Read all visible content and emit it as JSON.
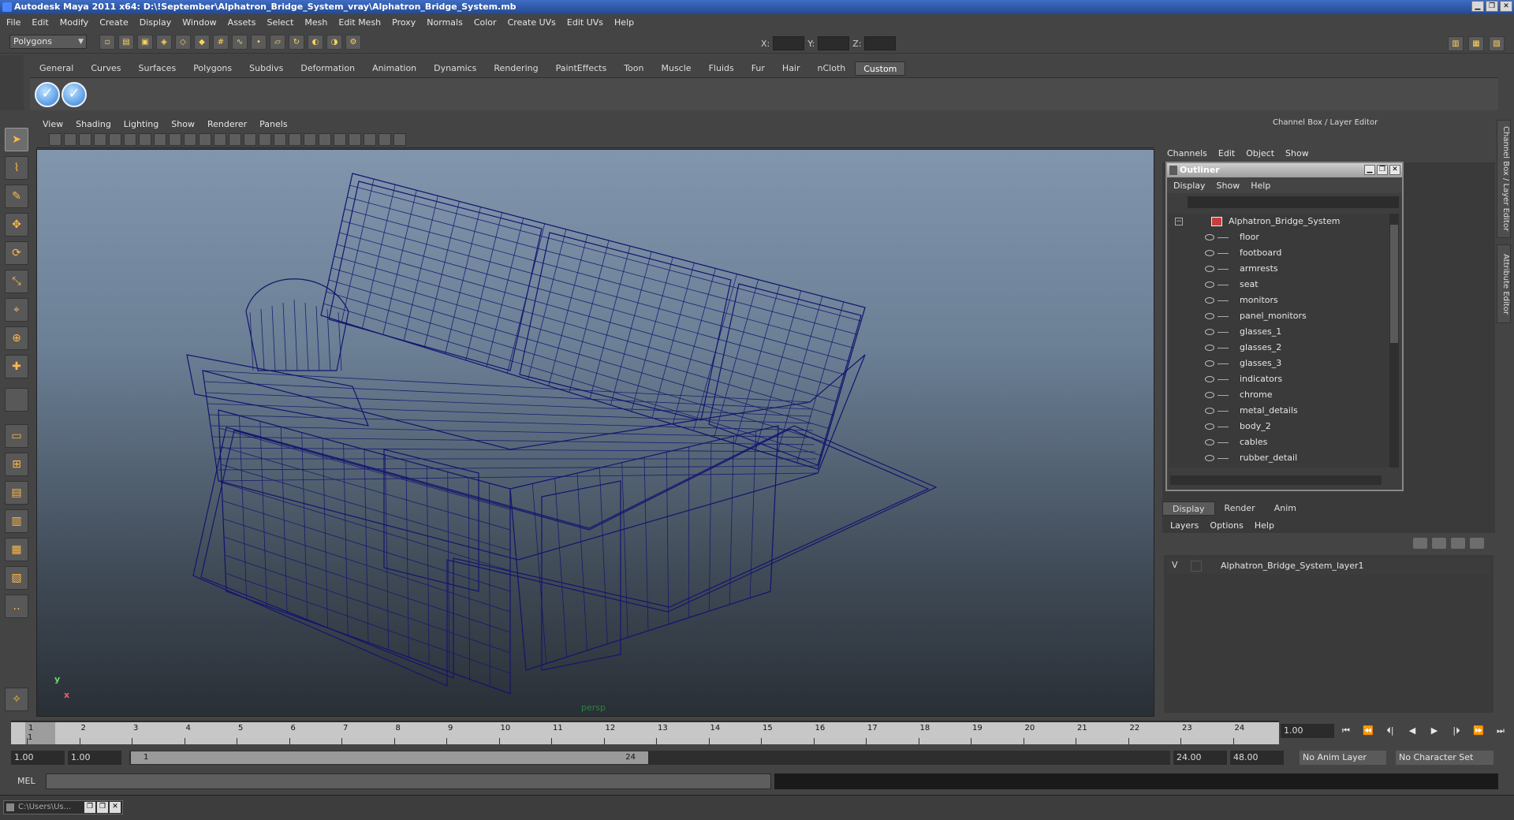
{
  "window": {
    "title": "Autodesk Maya 2011 x64: D:\\!September\\Alphatron_Bridge_System_vray\\Alphatron_Bridge_System.mb",
    "minimize": "▁",
    "maximize": "❐",
    "close": "✕"
  },
  "menubar": [
    "File",
    "Edit",
    "Modify",
    "Create",
    "Display",
    "Window",
    "Assets",
    "Select",
    "Mesh",
    "Edit Mesh",
    "Proxy",
    "Normals",
    "Color",
    "Create UVs",
    "Edit UVs",
    "Help"
  ],
  "statusline": {
    "mode": "Polygons",
    "x_label": "X:",
    "y_label": "Y:",
    "z_label": "Z:"
  },
  "shelf": {
    "tabs": [
      "General",
      "Curves",
      "Surfaces",
      "Polygons",
      "Subdivs",
      "Deformation",
      "Animation",
      "Dynamics",
      "Rendering",
      "PaintEffects",
      "Toon",
      "Muscle",
      "Fluids",
      "Fur",
      "Hair",
      "nCloth",
      "Custom"
    ],
    "active_tab": "Custom",
    "buttons": [
      "✓",
      "✓"
    ]
  },
  "viewport": {
    "menu": [
      "View",
      "Shading",
      "Lighting",
      "Show",
      "Renderer",
      "Panels"
    ],
    "camera": "persp",
    "axis_y": "y",
    "axis_x": "x",
    "wire_color": "#14146e"
  },
  "channelbox": {
    "title": "Channel Box / Layer Editor",
    "menu": [
      "Channels",
      "Edit",
      "Object",
      "Show"
    ]
  },
  "outliner": {
    "title": "Outliner",
    "menu": [
      "Display",
      "Show",
      "Help"
    ],
    "root": "Alphatron_Bridge_System",
    "collapse": "−",
    "items": [
      "floor",
      "footboard",
      "armrests",
      "seat",
      "monitors",
      "panel_monitors",
      "glasses_1",
      "glasses_2",
      "glasses_3",
      "indicators",
      "chrome",
      "metal_details",
      "body_2",
      "cables",
      "rubber_detail"
    ]
  },
  "layer_editor": {
    "tabs": [
      "Display",
      "Render",
      "Anim"
    ],
    "active_tab": "Display",
    "menu": [
      "Layers",
      "Options",
      "Help"
    ],
    "layer_visible": "V",
    "layer_name": "Alphatron_Bridge_System_layer1"
  },
  "side_tabs": [
    "Channel Box / Layer Editor",
    "Attribute Editor"
  ],
  "timeline": {
    "ticks": [
      "1",
      "2",
      "3",
      "4",
      "5",
      "6",
      "7",
      "8",
      "9",
      "10",
      "11",
      "12",
      "13",
      "14",
      "15",
      "16",
      "17",
      "18",
      "19",
      "20",
      "21",
      "22",
      "23",
      "24"
    ],
    "current_frame_label": "1",
    "current_time": "1.00",
    "playback_controls": [
      "⏮",
      "⏪",
      "⏴|",
      "◀",
      "▶",
      "|⏵",
      "⏩",
      "⏭"
    ]
  },
  "range": {
    "start": "1.00",
    "playback_start": "1.00",
    "thumb_start": "1",
    "thumb_end": "24",
    "playback_end": "24.00",
    "end": "48.00",
    "anim_layer": "No Anim Layer",
    "character_set": "No Character Set"
  },
  "cmdline": {
    "label": "MEL"
  },
  "taskbar": {
    "item": "C:\\Users\\Us..."
  }
}
